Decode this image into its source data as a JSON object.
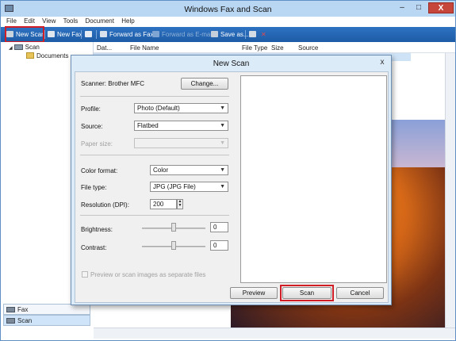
{
  "window": {
    "title": "Windows Fax and Scan",
    "controls": {
      "minimize": "–",
      "maximize": "□",
      "close": "X"
    }
  },
  "menu": [
    "File",
    "Edit",
    "View",
    "Tools",
    "Document",
    "Help"
  ],
  "toolbar": {
    "new_scan": "New Scan",
    "new_fax": "New Fax",
    "forward_as_fax": "Forward as Fax",
    "forward_as_email": "Forward as E-mail",
    "save_as": "Save as...",
    "highlight_color": "#d11d26"
  },
  "tree": {
    "root": "Scan",
    "child": "Documents"
  },
  "sidebar": {
    "fax": "Fax",
    "scan": "Scan"
  },
  "list": {
    "columns": [
      "Dat...",
      "File Name",
      "File Type",
      "Size",
      "Source"
    ]
  },
  "dialog": {
    "title": "New Scan",
    "close": "x",
    "scanner_label": "Scanner: Brother MFC",
    "change_button": "Change...",
    "profile": {
      "label": "Profile:",
      "value": "Photo (Default)"
    },
    "source": {
      "label": "Source:",
      "value": "Flatbed"
    },
    "paper_size": {
      "label": "Paper size:",
      "value": ""
    },
    "color_format": {
      "label": "Color format:",
      "value": "Color"
    },
    "file_type": {
      "label": "File type:",
      "value": "JPG (JPG File)"
    },
    "resolution": {
      "label": "Resolution (DPI):",
      "value": "200"
    },
    "brightness": {
      "label": "Brightness:",
      "value": "0"
    },
    "contrast": {
      "label": "Contrast:",
      "value": "0"
    },
    "separate_files": "Preview or scan images as separate files",
    "buttons": {
      "preview": "Preview",
      "scan": "Scan",
      "cancel": "Cancel"
    }
  }
}
